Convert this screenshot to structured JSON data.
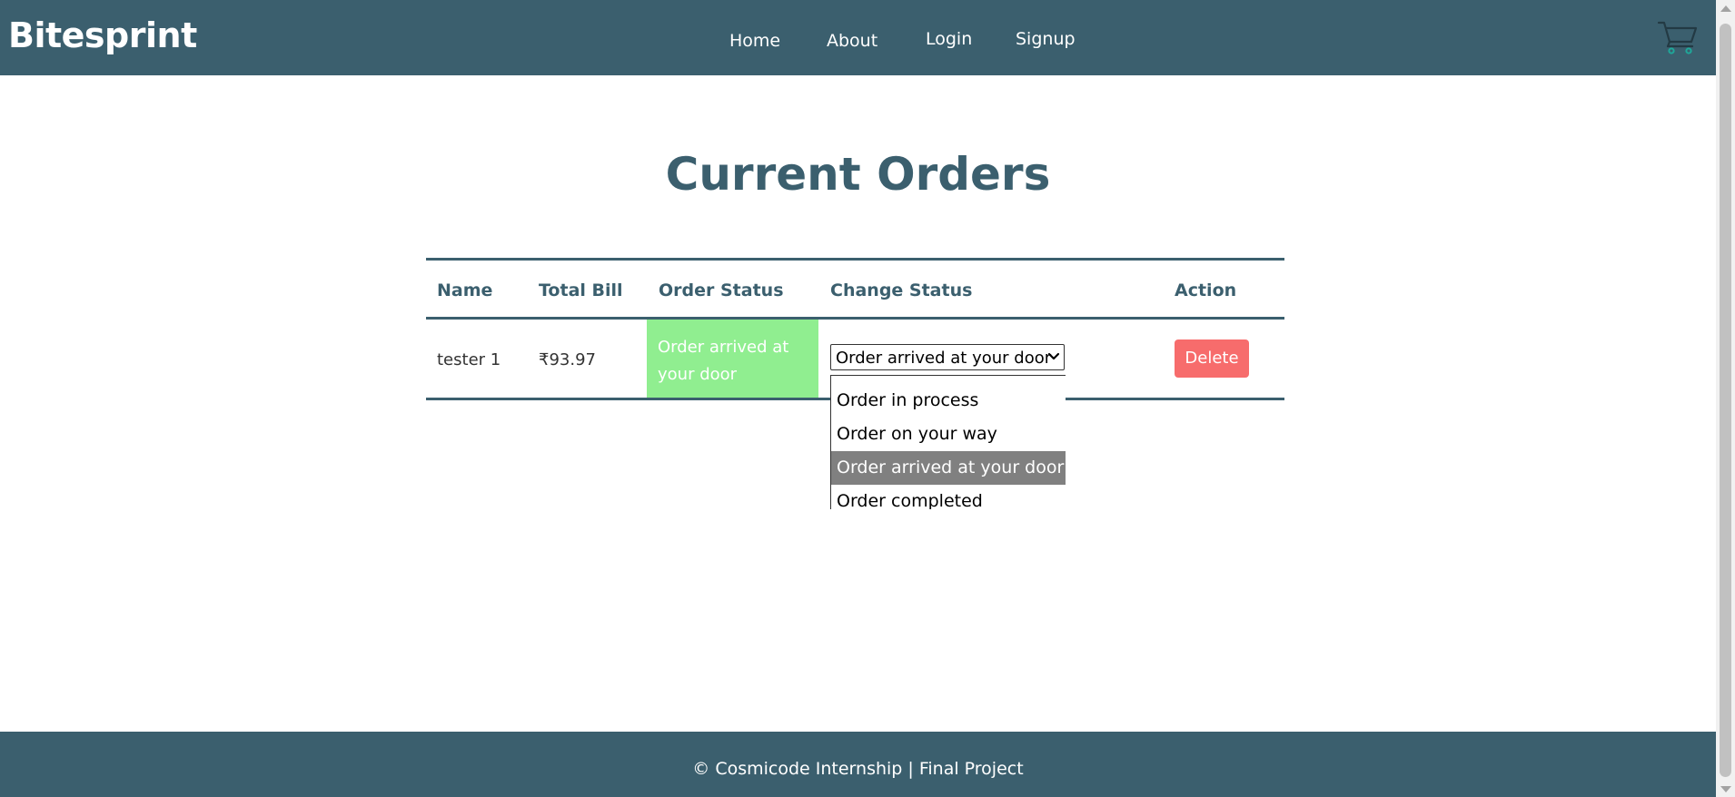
{
  "header": {
    "brand": "Bitesprint",
    "nav": {
      "home": "Home",
      "about": "About",
      "login": "Login",
      "signup": "Signup"
    },
    "cart_icon": "cart-icon"
  },
  "main": {
    "title": "Current Orders",
    "table": {
      "columns": [
        "Name",
        "Total Bill",
        "Order Status",
        "Change Status",
        "Action"
      ],
      "rows": [
        {
          "name": "tester 1",
          "total_bill": "₹93.97",
          "order_status": "Order arrived at your door",
          "change_status_value": "Order arrived at your door",
          "action_label": "Delete"
        }
      ]
    },
    "status_dropdown": {
      "options": [
        "Order in process",
        "Order on your way",
        "Order arrived at your door",
        "Order completed"
      ],
      "selected": "Order arrived at your door"
    }
  },
  "footer": {
    "text": "© Cosmicode Internship | Final Project"
  },
  "colors": {
    "primary": "#3b5f6e",
    "status_green": "#90ee90",
    "delete_red": "#f76c6c",
    "option_highlight": "#808080"
  }
}
